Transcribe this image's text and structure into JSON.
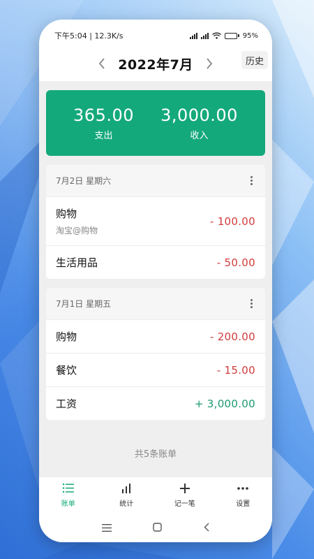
{
  "status_bar": {
    "time_speed": "下午5:04 | 12.3K/s",
    "battery": "95%",
    "battery_level": 0.95
  },
  "header": {
    "title": "2022年7月",
    "history_label": "历史",
    "prev_icon": "chevron-left-icon",
    "next_icon": "chevron-right-icon"
  },
  "summary": {
    "expense_value": "365.00",
    "expense_label": "支出",
    "income_value": "3,000.00",
    "income_label": "收入",
    "color": "#14a97a"
  },
  "days": [
    {
      "date": "7月2日 星期六",
      "entries": [
        {
          "name": "购物",
          "note": "淘宝@购物",
          "amount": "- 100.00",
          "kind": "expense"
        },
        {
          "name": "生活用品",
          "note": "",
          "amount": "- 50.00",
          "kind": "expense"
        }
      ]
    },
    {
      "date": "7月1日 星期五",
      "entries": [
        {
          "name": "购物",
          "note": "",
          "amount": "- 200.00",
          "kind": "expense"
        },
        {
          "name": "餐饮",
          "note": "",
          "amount": "- 15.00",
          "kind": "expense"
        },
        {
          "name": "工资",
          "note": "",
          "amount": "+ 3,000.00",
          "kind": "income"
        }
      ]
    }
  ],
  "total_count": "共5条账单",
  "tabs": [
    {
      "label": "账单",
      "icon": "list-icon",
      "active": true
    },
    {
      "label": "统计",
      "icon": "bar-chart-icon",
      "active": false
    },
    {
      "label": "记一笔",
      "icon": "plus-icon",
      "active": false
    },
    {
      "label": "设置",
      "icon": "more-icon",
      "active": false
    }
  ],
  "system_nav": [
    "menu-icon",
    "home-icon",
    "back-icon"
  ],
  "colors": {
    "accent": "#14a97a",
    "expense": "#d23b3b",
    "income": "#1a9a6c"
  }
}
